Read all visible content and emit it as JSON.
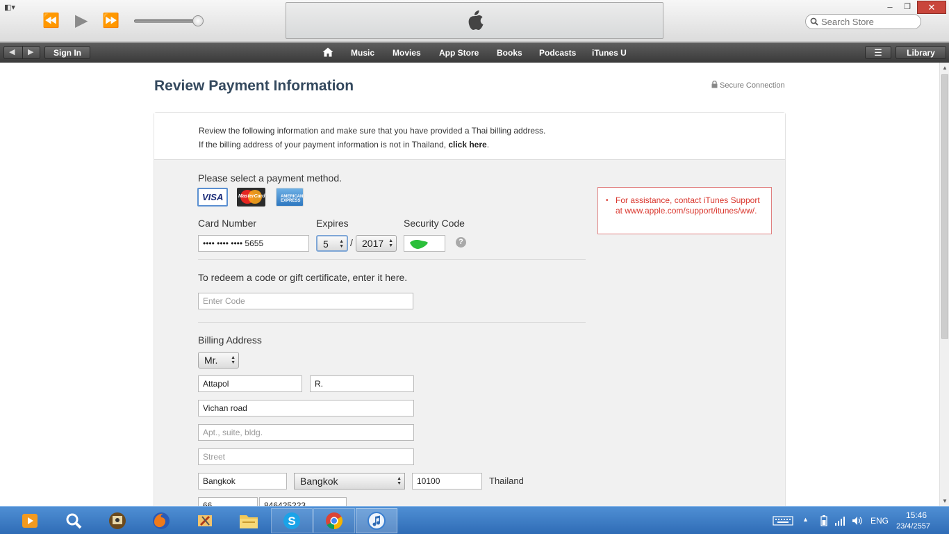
{
  "window": {
    "minimize": "–",
    "restore": "❐",
    "close": "✕",
    "menu_glyph": "◧▾"
  },
  "player": {
    "rewind_icon": "⏪",
    "play_icon": "▶",
    "forward_icon": "⏩"
  },
  "search": {
    "placeholder": "Search Store"
  },
  "nav": {
    "back": "◀",
    "forward": "▶",
    "sign_in": "Sign In",
    "links": [
      "Music",
      "Movies",
      "App Store",
      "Books",
      "Podcasts",
      "iTunes U"
    ],
    "menu_glyph": "☰",
    "library": "Library"
  },
  "page": {
    "title": "Review Payment Information",
    "secure": "Secure Connection",
    "notice_line1": "Review the following information and make sure that you have provided a Thai billing address.",
    "notice_line2_prefix": "If the billing address of your payment information is not in Thailand, ",
    "notice_link": "click here",
    "notice_line2_suffix": "."
  },
  "payment": {
    "select_label": "Please select a payment method.",
    "cards": {
      "visa": "VISA",
      "mastercard": "MasterCard",
      "amex": "AMERICAN EXPRESS"
    },
    "card_number_label": "Card Number",
    "card_number_value": "•••• •••• •••• 5655",
    "expires_label": "Expires",
    "expires_month": "5",
    "expires_sep": "/",
    "expires_year": "2017",
    "security_label": "Security Code",
    "help": "?"
  },
  "assistance": {
    "bullet": "•",
    "text": "For assistance, contact iTunes Support at www.apple.com/support/itunes/ww/."
  },
  "redeem": {
    "label": "To redeem a code or gift certificate, enter it here.",
    "placeholder": "Enter Code"
  },
  "billing": {
    "label": "Billing Address",
    "salutation": "Mr.",
    "first_name": "Attapol",
    "last_name": "R.",
    "address1": "Vichan road",
    "address2_placeholder": "Apt., suite, bldg.",
    "street_placeholder": "Street",
    "city": "Bangkok",
    "province": "Bangkok",
    "postal_code": "10100",
    "country": "Thailand",
    "phone_code": "66",
    "phone_number": "846425223"
  },
  "taskbar": {
    "language": "ENG",
    "time": "15:46",
    "date": "23/4/2557"
  },
  "colors": {
    "title": "#34495e",
    "error": "#d9342b",
    "taskbar": "#3a78c2"
  }
}
